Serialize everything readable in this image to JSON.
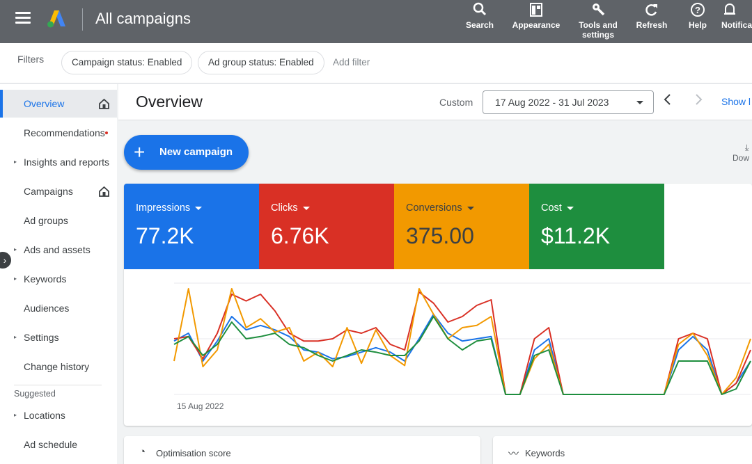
{
  "header": {
    "title": "All campaigns",
    "tools": [
      {
        "label": "Search",
        "icon": "search-icon"
      },
      {
        "label": "Appearance",
        "icon": "appearance-icon"
      },
      {
        "label": "Tools and settings",
        "icon": "wrench-icon"
      },
      {
        "label": "Refresh",
        "icon": "refresh-icon"
      },
      {
        "label": "Help",
        "icon": "help-icon"
      },
      {
        "label": "Notifica",
        "icon": "bell-icon"
      }
    ]
  },
  "filters": {
    "label": "Filters",
    "chips": [
      "Campaign status: Enabled",
      "Ad group status: Enabled"
    ],
    "add_filter": "Add filter"
  },
  "sidebar": {
    "items": [
      {
        "label": "Overview",
        "active": true,
        "home": true
      },
      {
        "label": "Recommendations",
        "dot": true
      },
      {
        "label": "Insights and reports",
        "expandable": true
      },
      {
        "label": "Campaigns",
        "home": true
      },
      {
        "label": "Ad groups"
      },
      {
        "label": "Ads and assets",
        "expandable": true
      },
      {
        "label": "Keywords",
        "expandable": true
      },
      {
        "label": "Audiences"
      },
      {
        "label": "Settings",
        "expandable": true
      },
      {
        "label": "Change history"
      }
    ],
    "suggested_label": "Suggested",
    "suggested": [
      {
        "label": "Locations",
        "expandable": true
      },
      {
        "label": "Ad schedule"
      }
    ]
  },
  "overview": {
    "title": "Overview",
    "custom_label": "Custom",
    "date_range": "17 Aug 2022 - 31 Jul 2023",
    "show_link": "Show l",
    "new_campaign": "New campaign",
    "download": "Dow"
  },
  "metrics": [
    {
      "name": "Impressions",
      "value": "77.2K",
      "color": "#1a73e8",
      "text_color": "#ffffff"
    },
    {
      "name": "Clicks",
      "value": "6.76K",
      "color": "#d93025",
      "text_color": "#ffffff"
    },
    {
      "name": "Conversions",
      "value": "375.00",
      "color": "#f29900",
      "text_color": "#3c4043"
    },
    {
      "name": "Cost",
      "value": "$11.2K",
      "color": "#1e8e3e",
      "text_color": "#ffffff"
    }
  ],
  "chart_data": {
    "type": "line",
    "x_start_label": "15 Aug 2022",
    "grid": true,
    "y_range": [
      0,
      100
    ],
    "series": [
      {
        "color": "#1a73e8",
        "values": [
          48,
          55,
          30,
          48,
          70,
          58,
          62,
          58,
          52,
          40,
          38,
          32,
          34,
          38,
          42,
          38,
          30,
          50,
          72,
          55,
          48,
          50,
          52,
          0,
          0,
          40,
          50,
          0,
          0,
          0,
          0,
          0,
          0,
          0,
          0,
          40,
          52,
          40,
          0,
          10,
          30
        ]
      },
      {
        "color": "#d93025",
        "values": [
          50,
          52,
          32,
          55,
          90,
          84,
          90,
          75,
          55,
          48,
          48,
          50,
          58,
          55,
          60,
          45,
          40,
          92,
          82,
          65,
          70,
          80,
          85,
          0,
          0,
          50,
          60,
          0,
          0,
          0,
          0,
          0,
          0,
          0,
          0,
          50,
          55,
          50,
          0,
          10,
          40
        ]
      },
      {
        "color": "#f29900",
        "values": [
          30,
          95,
          25,
          40,
          95,
          60,
          68,
          56,
          60,
          30,
          38,
          25,
          60,
          28,
          58,
          35,
          26,
          95,
          72,
          50,
          60,
          62,
          70,
          0,
          0,
          32,
          45,
          0,
          0,
          0,
          0,
          0,
          0,
          0,
          0,
          45,
          55,
          35,
          0,
          15,
          50
        ]
      },
      {
        "color": "#1e8e3e",
        "values": [
          45,
          52,
          35,
          45,
          65,
          50,
          52,
          55,
          45,
          42,
          35,
          30,
          35,
          40,
          38,
          35,
          35,
          48,
          70,
          50,
          40,
          48,
          50,
          0,
          0,
          35,
          40,
          0,
          0,
          0,
          0,
          0,
          0,
          0,
          0,
          30,
          30,
          30,
          0,
          5,
          30
        ]
      }
    ]
  },
  "bottom_cards": [
    {
      "title": "Optimisation score",
      "icon": "gauge-icon"
    },
    {
      "title": "Keywords",
      "icon": "trend-icon"
    }
  ]
}
